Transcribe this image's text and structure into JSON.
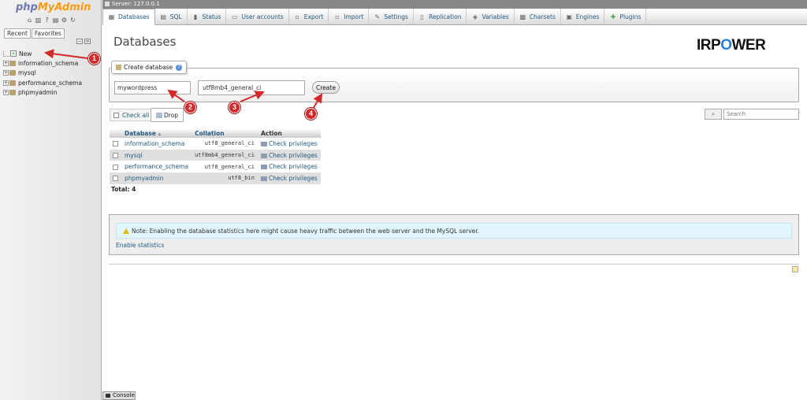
{
  "sidebar": {
    "logo_php": "php",
    "logo_myadmin": "MyAdmin",
    "recent_tab": "Recent",
    "favorites_tab": "Favorites",
    "new_item": "New",
    "databases": [
      "information_schema",
      "mysql",
      "performance_schema",
      "phpmyadmin"
    ]
  },
  "serverbar": {
    "label": "Server: 127.0.0.1"
  },
  "tabs": [
    {
      "label": "Databases",
      "icon": "database-icon"
    },
    {
      "label": "SQL",
      "icon": "sql-icon"
    },
    {
      "label": "Status",
      "icon": "status-icon"
    },
    {
      "label": "User accounts",
      "icon": "users-icon"
    },
    {
      "label": "Export",
      "icon": "export-icon"
    },
    {
      "label": "Import",
      "icon": "import-icon"
    },
    {
      "label": "Settings",
      "icon": "wrench-icon"
    },
    {
      "label": "Replication",
      "icon": "replication-icon"
    },
    {
      "label": "Variables",
      "icon": "variables-icon"
    },
    {
      "label": "Charsets",
      "icon": "charsets-icon"
    },
    {
      "label": "Engines",
      "icon": "engines-icon"
    },
    {
      "label": "Plugins",
      "icon": "plugins-icon"
    }
  ],
  "main": {
    "title": "Databases",
    "brand_ir": "IRP",
    "brand_o": "O",
    "brand_rest": "WER",
    "create": {
      "legend": "Create database",
      "db_name_value": "mywordpress",
      "collation_value": "utf8mb4_general_ci",
      "create_label": "Create"
    },
    "check_all_label": "Check all",
    "drop_label": "Drop",
    "search_placeholder": "Search",
    "table": {
      "headers": {
        "database": "Database",
        "collation": "Collation",
        "action": "Action"
      },
      "rows": [
        {
          "name": "information_schema",
          "collation": "utf8_general_ci",
          "action": "Check privileges"
        },
        {
          "name": "mysql",
          "collation": "utf8mb4_general_ci",
          "action": "Check privileges"
        },
        {
          "name": "performance_schema",
          "collation": "utf8_general_ci",
          "action": "Check privileges"
        },
        {
          "name": "phpmyadmin",
          "collation": "utf8_bin",
          "action": "Check privileges"
        }
      ],
      "total": "Total: 4"
    },
    "notice": "Note: Enabling the database statistics here might cause heavy traffic between the web server and the MySQL server.",
    "enable_stats": "Enable statistics"
  },
  "console_label": "Console",
  "markers": [
    "1",
    "2",
    "3",
    "4"
  ]
}
